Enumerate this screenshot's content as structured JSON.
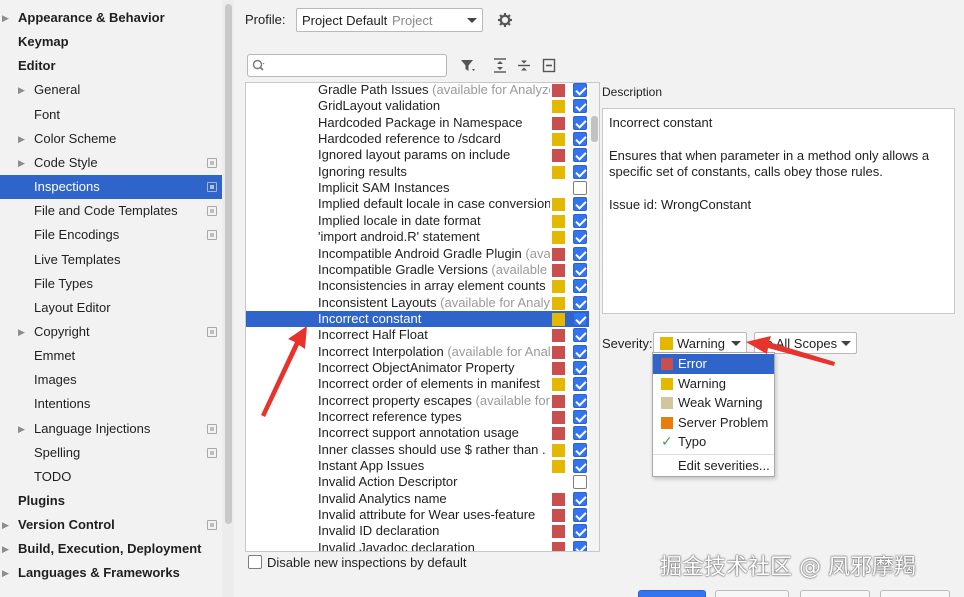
{
  "sidebar": {
    "items": [
      {
        "label": "Appearance & Behavior",
        "indent": 0,
        "bold": true,
        "arrow": true,
        "proj": false,
        "selected": false
      },
      {
        "label": "Keymap",
        "indent": 0,
        "bold": true,
        "arrow": false,
        "proj": false,
        "selected": false
      },
      {
        "label": "Editor",
        "indent": 0,
        "bold": true,
        "arrow": false,
        "proj": false,
        "selected": false
      },
      {
        "label": "General",
        "indent": 1,
        "bold": false,
        "arrow": true,
        "proj": false,
        "selected": false
      },
      {
        "label": "Font",
        "indent": 1,
        "bold": false,
        "arrow": false,
        "proj": false,
        "selected": false
      },
      {
        "label": "Color Scheme",
        "indent": 1,
        "bold": false,
        "arrow": true,
        "proj": false,
        "selected": false
      },
      {
        "label": "Code Style",
        "indent": 1,
        "bold": false,
        "arrow": true,
        "proj": true,
        "selected": false
      },
      {
        "label": "Inspections",
        "indent": 1,
        "bold": false,
        "arrow": false,
        "proj": true,
        "selected": true
      },
      {
        "label": "File and Code Templates",
        "indent": 1,
        "bold": false,
        "arrow": false,
        "proj": true,
        "selected": false
      },
      {
        "label": "File Encodings",
        "indent": 1,
        "bold": false,
        "arrow": false,
        "proj": true,
        "selected": false
      },
      {
        "label": "Live Templates",
        "indent": 1,
        "bold": false,
        "arrow": false,
        "proj": false,
        "selected": false
      },
      {
        "label": "File Types",
        "indent": 1,
        "bold": false,
        "arrow": false,
        "proj": false,
        "selected": false
      },
      {
        "label": "Layout Editor",
        "indent": 1,
        "bold": false,
        "arrow": false,
        "proj": false,
        "selected": false
      },
      {
        "label": "Copyright",
        "indent": 1,
        "bold": false,
        "arrow": true,
        "proj": true,
        "selected": false
      },
      {
        "label": "Emmet",
        "indent": 1,
        "bold": false,
        "arrow": false,
        "proj": false,
        "selected": false
      },
      {
        "label": "Images",
        "indent": 1,
        "bold": false,
        "arrow": false,
        "proj": false,
        "selected": false
      },
      {
        "label": "Intentions",
        "indent": 1,
        "bold": false,
        "arrow": false,
        "proj": false,
        "selected": false
      },
      {
        "label": "Language Injections",
        "indent": 1,
        "bold": false,
        "arrow": true,
        "proj": true,
        "selected": false
      },
      {
        "label": "Spelling",
        "indent": 1,
        "bold": false,
        "arrow": false,
        "proj": true,
        "selected": false
      },
      {
        "label": "TODO",
        "indent": 1,
        "bold": false,
        "arrow": false,
        "proj": false,
        "selected": false
      },
      {
        "label": "Plugins",
        "indent": 0,
        "bold": true,
        "arrow": false,
        "proj": false,
        "selected": false
      },
      {
        "label": "Version Control",
        "indent": 0,
        "bold": true,
        "arrow": true,
        "proj": true,
        "selected": false
      },
      {
        "label": "Build, Execution, Deployment",
        "indent": 0,
        "bold": true,
        "arrow": true,
        "proj": false,
        "selected": false
      },
      {
        "label": "Languages & Frameworks",
        "indent": 0,
        "bold": true,
        "arrow": true,
        "proj": false,
        "selected": false
      }
    ]
  },
  "profile": {
    "label": "Profile:",
    "value": "Project Default",
    "scope": "Project"
  },
  "icons": {
    "search": "search-icon",
    "filter": "filter-icon",
    "expand_all": "expand-all-icon",
    "collapse_all": "collapse-all-icon",
    "reset": "reset-icon",
    "gear": "gear-icon"
  },
  "colors": {
    "error": "#c94f4f",
    "warning": "#e5b800",
    "weak_warning": "#d4c5a1",
    "server_problem": "#e87d0e",
    "typo": "#4aa14a",
    "selection": "#2f65ca",
    "checkbox": "#3574f0"
  },
  "inspections": [
    {
      "name": "Gradle Path Issues",
      "hint": " (available for Analyze|",
      "severity": "error",
      "checked": true
    },
    {
      "name": "GridLayout validation",
      "hint": "",
      "severity": "warning",
      "checked": true
    },
    {
      "name": "Hardcoded Package in Namespace",
      "hint": "",
      "severity": "error",
      "checked": true
    },
    {
      "name": "Hardcoded reference to /sdcard",
      "hint": "",
      "severity": "warning",
      "checked": true
    },
    {
      "name": "Ignored layout params on include",
      "hint": "",
      "severity": "error",
      "checked": true
    },
    {
      "name": "Ignoring results",
      "hint": "",
      "severity": "warning",
      "checked": true
    },
    {
      "name": "Implicit SAM Instances",
      "hint": "",
      "severity": "none",
      "checked": false
    },
    {
      "name": "Implied default locale in case conversion",
      "hint": "",
      "severity": "warning",
      "checked": true
    },
    {
      "name": "Implied locale in date format",
      "hint": "",
      "severity": "warning",
      "checked": true
    },
    {
      "name": "'import android.R' statement",
      "hint": "",
      "severity": "warning",
      "checked": true
    },
    {
      "name": "Incompatible Android Gradle Plugin",
      "hint": " (avai",
      "severity": "error",
      "checked": true
    },
    {
      "name": "Incompatible Gradle Versions",
      "hint": " (available f",
      "severity": "error",
      "checked": true
    },
    {
      "name": "Inconsistencies in array element counts",
      "hint": "",
      "severity": "warning",
      "checked": true
    },
    {
      "name": "Inconsistent Layouts",
      "hint": " (available for Analyz",
      "severity": "warning",
      "checked": true
    },
    {
      "name": "Incorrect constant",
      "hint": "",
      "severity": "warning",
      "checked": true,
      "selected": true
    },
    {
      "name": "Incorrect Half Float",
      "hint": "",
      "severity": "error",
      "checked": true
    },
    {
      "name": "Incorrect Interpolation",
      "hint": " (available for Anal",
      "severity": "error",
      "checked": true
    },
    {
      "name": "Incorrect ObjectAnimator Property",
      "hint": "",
      "severity": "error",
      "checked": true
    },
    {
      "name": "Incorrect order of elements in manifest",
      "hint": "",
      "severity": "warning",
      "checked": true
    },
    {
      "name": "Incorrect property escapes",
      "hint": " (available for",
      "severity": "error",
      "checked": true
    },
    {
      "name": "Incorrect reference types",
      "hint": "",
      "severity": "error",
      "checked": true
    },
    {
      "name": "Incorrect support annotation usage",
      "hint": "",
      "severity": "error",
      "checked": true
    },
    {
      "name": "Inner classes should use $ rather than .",
      "hint": "",
      "severity": "warning",
      "checked": true
    },
    {
      "name": "Instant App Issues",
      "hint": "",
      "severity": "warning",
      "checked": true
    },
    {
      "name": "Invalid Action Descriptor",
      "hint": "",
      "severity": "none",
      "checked": false
    },
    {
      "name": "Invalid Analytics name",
      "hint": "",
      "severity": "error",
      "checked": true
    },
    {
      "name": "Invalid attribute for Wear uses-feature",
      "hint": "",
      "severity": "error",
      "checked": true
    },
    {
      "name": "Invalid ID declaration",
      "hint": "",
      "severity": "error",
      "checked": true
    },
    {
      "name": "Invalid Javadoc declaration",
      "hint": "",
      "severity": "error",
      "checked": true
    }
  ],
  "description": {
    "label": "Description",
    "title": "Incorrect constant",
    "body_line1": "Ensures that when parameter in a method only allows a",
    "body_line2": "specific set of constants, calls obey those rules.",
    "issue_id": "Issue id: WrongConstant"
  },
  "severity": {
    "label": "Severity:",
    "selected": "Warning",
    "scope": "In All Scopes",
    "options": [
      {
        "label": "Error",
        "color": "error",
        "highlighted": true
      },
      {
        "label": "Warning",
        "color": "warning",
        "highlighted": false
      },
      {
        "label": "Weak Warning",
        "color": "weak_warning",
        "highlighted": false
      },
      {
        "label": "Server Problem",
        "color": "server_problem",
        "highlighted": false
      },
      {
        "label": "Typo",
        "color": "typo",
        "highlighted": false
      }
    ],
    "edit_label": "Edit severities..."
  },
  "disable_new": {
    "label": "Disable new inspections by default",
    "checked": false
  },
  "watermark": "掘金技术社区 @ 凤邪摩羯"
}
